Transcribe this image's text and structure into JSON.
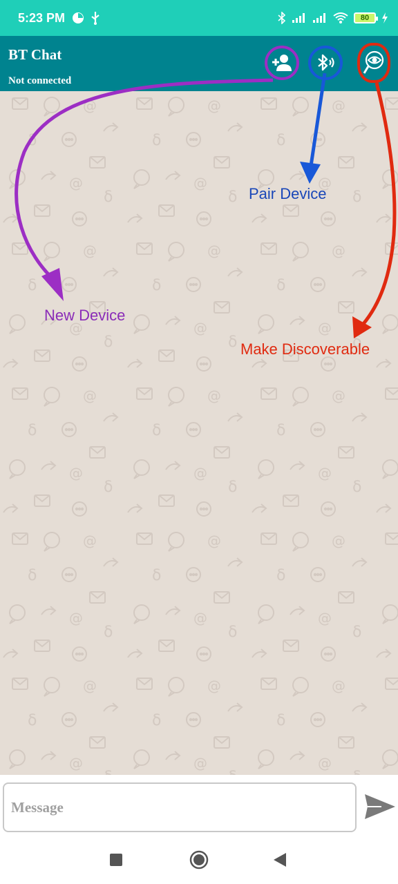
{
  "status_bar": {
    "time": "5:23 PM",
    "battery_level": "80",
    "icons": [
      "data-saver-icon",
      "usb-icon",
      "bluetooth-icon",
      "signal-icon",
      "signal-icon",
      "wifi-icon",
      "battery-icon",
      "charging-icon"
    ]
  },
  "app_bar": {
    "title": "BT Chat",
    "subtitle": "Not connected",
    "actions": [
      {
        "name": "new-device",
        "icon": "add-person-icon"
      },
      {
        "name": "pair-device",
        "icon": "bluetooth-audio-icon"
      },
      {
        "name": "make-discoverable",
        "icon": "eye-search-icon"
      }
    ]
  },
  "annotations": {
    "pair_device": "Pair Device",
    "new_device": "New Device",
    "make_discoverable": "Make Discoverable",
    "colors": {
      "new_device": "#8a2cb8",
      "pair_device": "#1a47b8",
      "make_discoverable": "#e02a10"
    }
  },
  "composer": {
    "placeholder": "Message",
    "send_icon": "send-icon"
  },
  "nav_bar": {
    "icons": [
      "recents-icon",
      "home-icon",
      "back-icon"
    ]
  },
  "colors": {
    "status_bar": "#1fcfb8",
    "app_bar": "#00838f",
    "chat_background": "#e5ddd5"
  }
}
